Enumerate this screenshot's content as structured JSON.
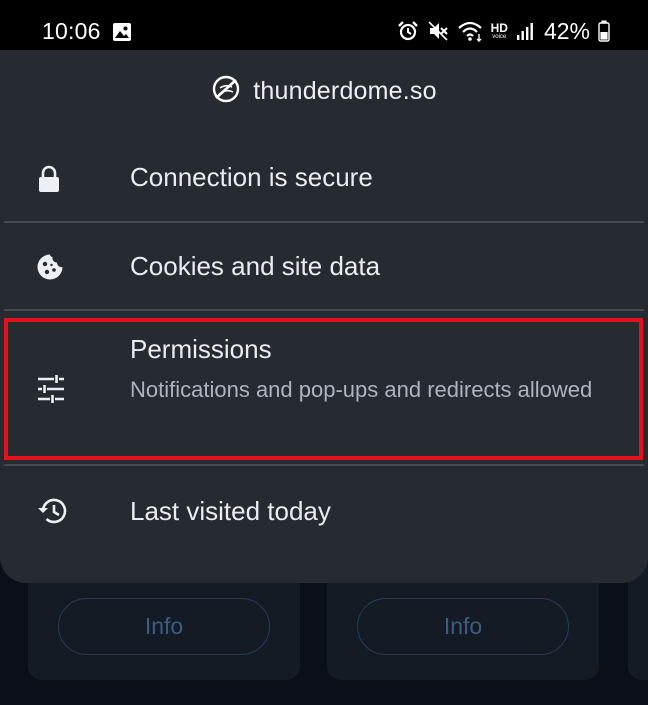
{
  "status_bar": {
    "time": "10:06",
    "hd_top": "HD",
    "hd_bottom": "voice",
    "battery": "42%"
  },
  "site_info": {
    "domain": "thunderdome.so",
    "rows": [
      {
        "title": "Connection is secure",
        "icon": "lock-icon"
      },
      {
        "title": "Cookies and site data",
        "icon": "cookie-icon"
      },
      {
        "title": "Permissions",
        "subtitle": "Notifications and pop-ups and redirects allowed",
        "icon": "tune-icon"
      },
      {
        "title": "Last visited today",
        "icon": "history-icon"
      }
    ]
  },
  "background": {
    "info_buttons": [
      "Info",
      "Info"
    ]
  },
  "colors": {
    "sheet": "#262a31",
    "highlight": "#e4111a",
    "page_bg": "#0b1018"
  }
}
